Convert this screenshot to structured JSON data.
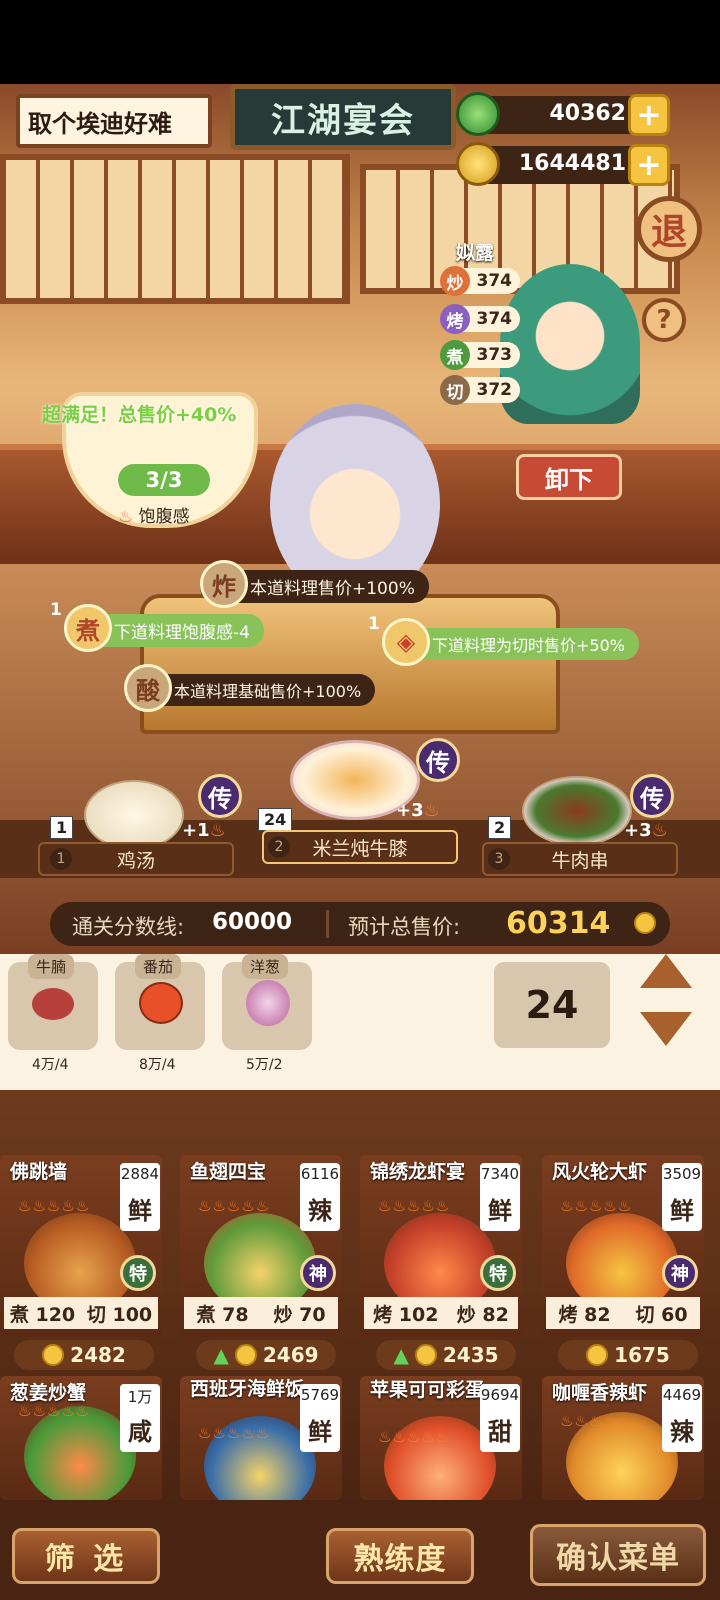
{
  "header": {
    "player_name": "取个埃迪好难",
    "sign": "江湖宴会",
    "jade": "40362",
    "coins": "1644481",
    "exit_label": "退"
  },
  "chef": {
    "name": "姒露",
    "skills": [
      {
        "icon": "炒",
        "value": "374",
        "color": "#e0703a"
      },
      {
        "icon": "烤",
        "value": "374",
        "color": "#8b5fbf"
      },
      {
        "icon": "煮",
        "value": "373",
        "color": "#4f9a3f"
      },
      {
        "icon": "切",
        "value": "372",
        "color": "#8a6a48"
      }
    ],
    "help": "?",
    "unload": "卸下"
  },
  "satisfaction": {
    "text": "超满足！总售价+40%",
    "count": "3/3",
    "label": "饱腹感"
  },
  "effects": [
    {
      "badge": "炸",
      "count": "",
      "text": "本道料理售价+100%"
    },
    {
      "badge": "煮",
      "count": "1",
      "text": "下道料理饱腹感-4"
    },
    {
      "badge": "",
      "count": "1",
      "text": "下道料理为切时售价+50%"
    },
    {
      "badge": "酸",
      "count": "",
      "text": "本道料理基础售价+100%"
    }
  ],
  "slots": [
    {
      "index": "1",
      "qty": "1",
      "name": "鸡汤",
      "bonus": "+1",
      "tag": "传"
    },
    {
      "index": "2",
      "qty": "24",
      "name": "米兰炖牛膝",
      "bonus": "+3",
      "tag": "传"
    },
    {
      "index": "3",
      "qty": "2",
      "name": "牛肉串",
      "bonus": "+3",
      "tag": "传"
    }
  ],
  "score": {
    "threshold_label": "通关分数线:",
    "threshold": "60000",
    "estimate_label": "预计总售价:",
    "estimate": "60314"
  },
  "ingredients": [
    {
      "name": "牛腩",
      "amount": "4万/4",
      "color": "#b8403a"
    },
    {
      "name": "番茄",
      "amount": "8万/4",
      "color": "#e8502a"
    },
    {
      "name": "洋葱",
      "amount": "5万/2",
      "color": "#b7609a"
    }
  ],
  "quantity": "24",
  "recipes": [
    {
      "name": "佛跳墙",
      "num": "2884",
      "taste": "鲜",
      "r1": "煮",
      "v1": "120",
      "r2": "切",
      "v2": "100",
      "price": "2482",
      "tag": "特"
    },
    {
      "name": "鱼翅四宝",
      "num": "6116",
      "taste": "辣",
      "r1": "煮",
      "v1": "78",
      "r2": "炒",
      "v2": "70",
      "price": "2469",
      "tag": "神"
    },
    {
      "name": "锦绣龙虾宴",
      "num": "7340",
      "taste": "鲜",
      "r1": "烤",
      "v1": "102",
      "r2": "炒",
      "v2": "82",
      "price": "2435",
      "tag": "特"
    },
    {
      "name": "风火轮大虾",
      "num": "3509",
      "taste": "鲜",
      "r1": "烤",
      "v1": "82",
      "r2": "切",
      "v2": "60",
      "price": "1675",
      "tag": "神"
    },
    {
      "name": "葱姜炒蟹",
      "num": "1万",
      "taste": "咸"
    },
    {
      "name": "西班牙海鲜饭",
      "num": "5769",
      "taste": "鲜"
    },
    {
      "name": "苹果可可彩蛋",
      "num": "9694",
      "taste": "甜"
    },
    {
      "name": "咖喱香辣虾",
      "num": "4469",
      "taste": "辣"
    }
  ],
  "buttons": {
    "filter": "筛 选",
    "proficiency": "熟练度",
    "confirm": "确认菜单"
  }
}
